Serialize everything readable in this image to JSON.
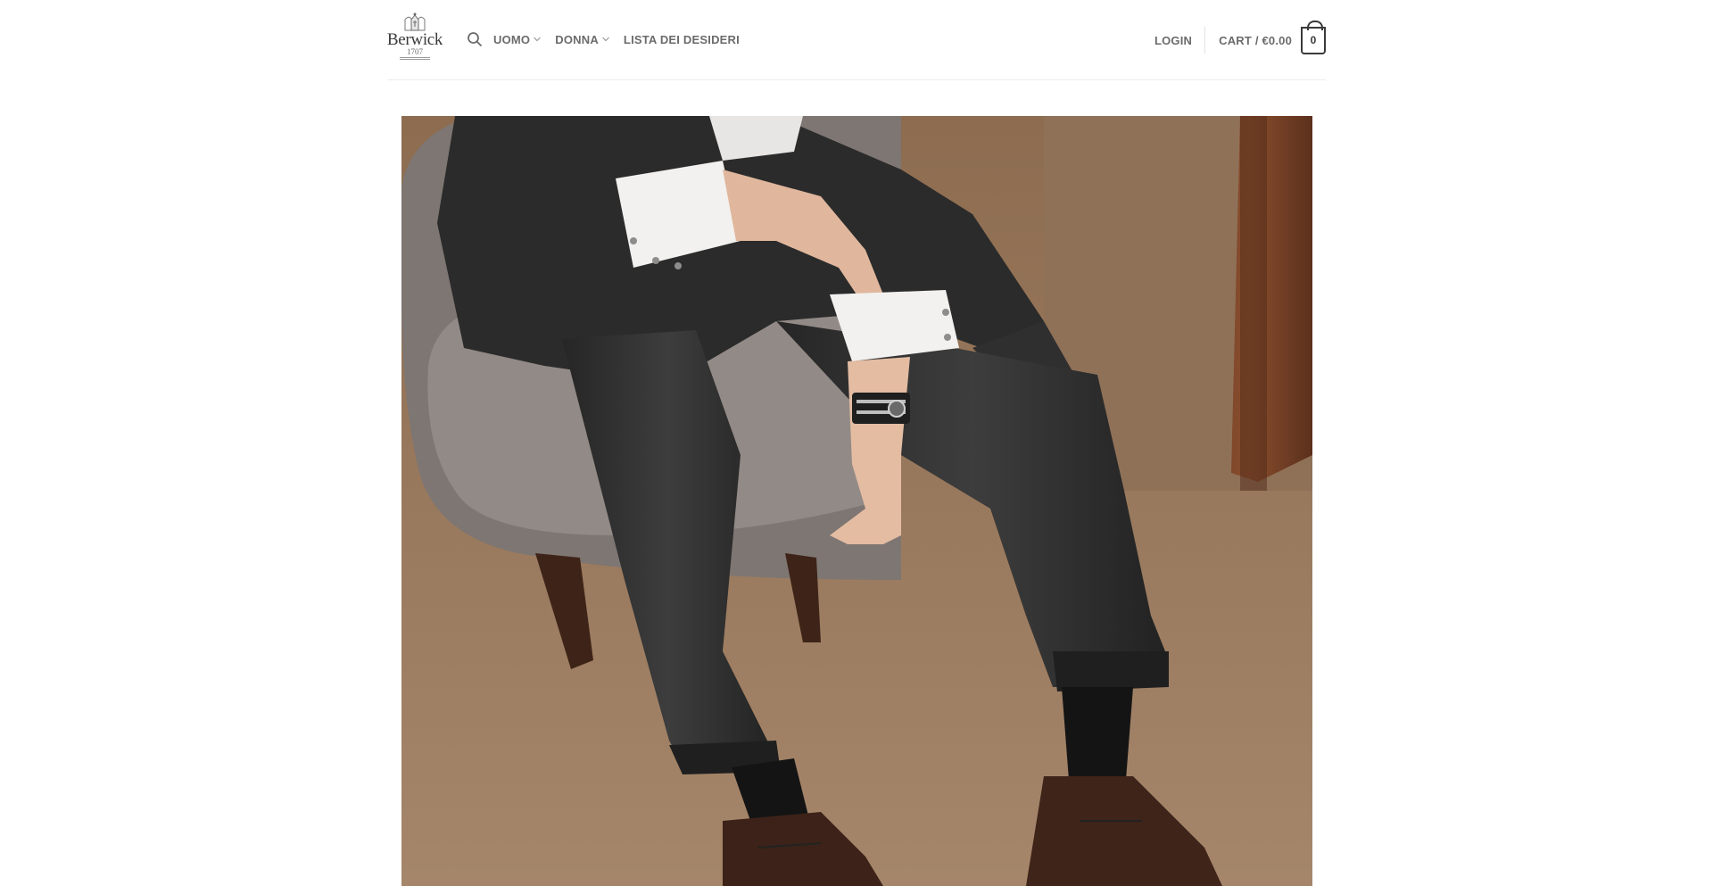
{
  "header": {
    "logo": {
      "brand": "Berwick",
      "year": "1707",
      "icon": "crest-logo-icon"
    },
    "nav": {
      "search_icon": "search-icon",
      "items": [
        {
          "label": "UOMO",
          "has_dropdown": true
        },
        {
          "label": "DONNA",
          "has_dropdown": true
        },
        {
          "label": "LISTA DEI DESIDERI",
          "has_dropdown": false
        }
      ]
    },
    "account": {
      "login_label": "LOGIN"
    },
    "cart": {
      "label": "CART / €0.00",
      "count": "0"
    }
  },
  "hero": {
    "image": "photo-man-in-grey-suit-seated-armchair-brown-oxford-shoes"
  },
  "colors": {
    "text": "#6b6b6b",
    "border": "#ececec",
    "cart_badge": "#3a3a3a",
    "background": "#ffffff"
  }
}
